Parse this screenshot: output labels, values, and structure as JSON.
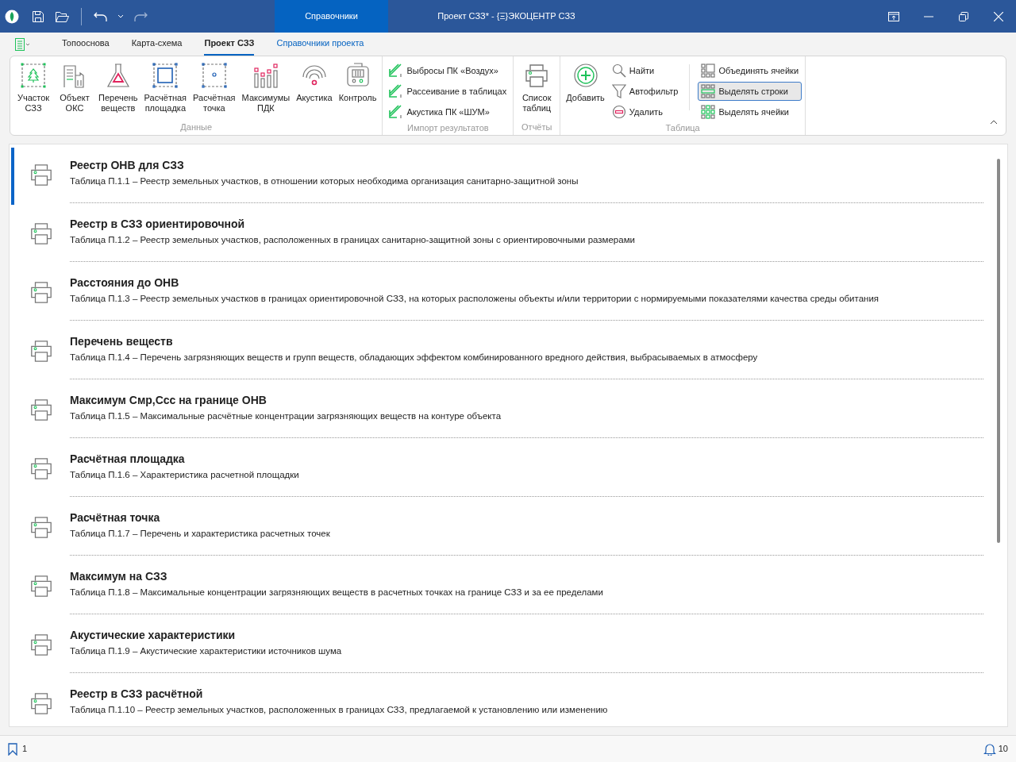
{
  "titlebar": {
    "context_tab": "Справочники",
    "title": "Проект СЗЗ* - {Ξ}ЭКОЦЕНТР СЗЗ"
  },
  "tabs": [
    {
      "label": "Топооснова",
      "selected": false,
      "kind": "normal"
    },
    {
      "label": "Карта-схема",
      "selected": false,
      "kind": "normal"
    },
    {
      "label": "Проект СЗЗ",
      "selected": true,
      "kind": "normal"
    },
    {
      "label": "Справочники проекта",
      "selected": false,
      "kind": "context"
    }
  ],
  "ribbon": {
    "groups": [
      {
        "label": "Данные",
        "items": [
          {
            "kind": "large",
            "label": "Участок СЗЗ"
          },
          {
            "kind": "large",
            "label": "Объект ОКС"
          },
          {
            "kind": "large",
            "label": "Перечень веществ"
          },
          {
            "kind": "large",
            "label": "Расчётная площадка"
          },
          {
            "kind": "large",
            "label": "Расчётная точка"
          },
          {
            "kind": "large",
            "label": "Максимумы ПДК"
          },
          {
            "kind": "large",
            "label": "Акустика"
          },
          {
            "kind": "large",
            "label": "Контроль"
          }
        ]
      },
      {
        "label": "Импорт результатов",
        "items": [
          {
            "kind": "small",
            "label": "Выбросы ПК «Воздух»"
          },
          {
            "kind": "small",
            "label": "Рассеивание в таблицах"
          },
          {
            "kind": "small",
            "label": "Акустика ПК «ШУМ»"
          }
        ]
      },
      {
        "label": "Отчёты",
        "items": [
          {
            "kind": "large",
            "label": "Список таблиц"
          }
        ]
      },
      {
        "label": "Таблица",
        "items": [
          {
            "kind": "large",
            "label": "Добавить"
          },
          {
            "kind": "small",
            "label": "Найти"
          },
          {
            "kind": "small",
            "label": "Автофильтр"
          },
          {
            "kind": "small",
            "label": "Удалить"
          },
          {
            "kind": "toggle",
            "label": "Объединять ячейки",
            "selected": false
          },
          {
            "kind": "toggle",
            "label": "Выделять строки",
            "selected": true
          },
          {
            "kind": "toggle",
            "label": "Выделять ячейки",
            "selected": false
          }
        ]
      }
    ]
  },
  "reports": [
    {
      "title": "Реестр ОНВ для СЗЗ",
      "description": "Таблица П.1.1 – Реестр земельных участков, в отношении которых необходима организация санитарно-защитной зоны",
      "selected": true
    },
    {
      "title": "Реестр в СЗЗ ориентировочной",
      "description": "Таблица П.1.2 – Реестр земельных участков, расположенных в границах санитарно-защитной зоны с ориентировочными размерами",
      "selected": false
    },
    {
      "title": "Расстояния до ОНВ",
      "description": "Таблица П.1.3 – Реестр земельных участков в границах ориентировочной СЗЗ, на которых расположены объекты и/или территории с нормируемыми показателями качества среды обитания",
      "selected": false
    },
    {
      "title": "Перечень веществ",
      "description": "Таблица П.1.4 – Перечень загрязняющих веществ и групп веществ, обладающих эффектом комбинированного вредного действия, выбрасываемых в атмосферу",
      "selected": false
    },
    {
      "title": "Максимум Смр,Ссс на границе ОНВ",
      "description": "Таблица П.1.5 – Максимальные расчётные концентрации загрязняющих веществ на контуре объекта",
      "selected": false
    },
    {
      "title": "Расчётная площадка",
      "description": "Таблица П.1.6 – Характеристика расчетной площадки",
      "selected": false
    },
    {
      "title": "Расчётная точка",
      "description": "Таблица П.1.7 – Перечень и характеристика расчетных точек",
      "selected": false
    },
    {
      "title": "Максимум на СЗЗ",
      "description": "Таблица П.1.8 – Максимальные концентрации загрязняющих веществ в расчетных точках на границе СЗЗ и за ее пределами",
      "selected": false
    },
    {
      "title": "Акустические характеристики",
      "description": "Таблица П.1.9 – Акустические характеристики источников шума",
      "selected": false
    },
    {
      "title": "Реестр в СЗЗ расчётной",
      "description": "Таблица П.1.10 – Реестр земельных участков, расположенных в границах СЗЗ, предлагаемой к установлению или изменению",
      "selected": false
    }
  ],
  "status_bar": {
    "bookmarks": "1",
    "notifications": "10"
  }
}
